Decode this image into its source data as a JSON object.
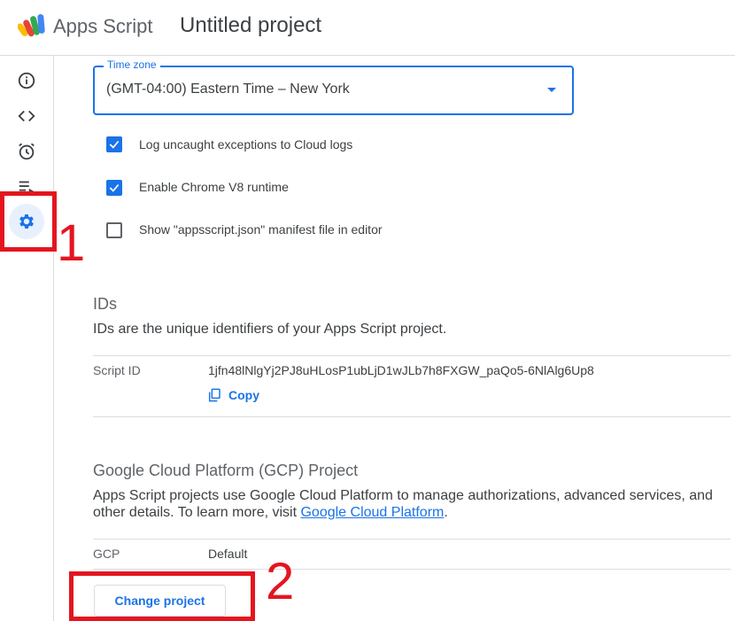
{
  "header": {
    "app_name": "Apps Script",
    "project_title": "Untitled project"
  },
  "rail": {
    "items": [
      {
        "icon": "info-icon"
      },
      {
        "icon": "code-icon"
      },
      {
        "icon": "alarm-clock-icon"
      },
      {
        "icon": "executions-icon"
      },
      {
        "icon": "gear-icon",
        "active": true
      }
    ]
  },
  "settings": {
    "timezone": {
      "label": "Time zone",
      "value": "(GMT-04:00) Eastern Time – New York"
    },
    "checkboxes": [
      {
        "label": "Log uncaught exceptions to Cloud logs",
        "checked": true
      },
      {
        "label": "Enable Chrome V8 runtime",
        "checked": true
      },
      {
        "label": "Show \"appsscript.json\" manifest file in editor",
        "checked": false
      }
    ]
  },
  "ids": {
    "title": "IDs",
    "description": "IDs are the unique identifiers of your Apps Script project.",
    "script_id_label": "Script ID",
    "script_id_value": "1jfn48lNlgYj2PJ8uHLosP1ubLjD1wJLb7h8FXGW_paQo5-6NlAlg6Up8",
    "copy_label": "Copy"
  },
  "gcp": {
    "title": "Google Cloud Platform (GCP) Project",
    "description_prefix": "Apps Script projects use Google Cloud Platform to manage authorizations, advanced services, and other details. To learn more, visit ",
    "description_link": "Google Cloud Platform",
    "description_suffix": ".",
    "key_label": "GCP",
    "key_value": "Default",
    "change_button": "Change project"
  },
  "annotations": {
    "marker_1": "1",
    "marker_2": "2",
    "color": "#e4151f"
  },
  "colors": {
    "accent": "#1a73e8",
    "active_bg": "#e8f0fe"
  }
}
